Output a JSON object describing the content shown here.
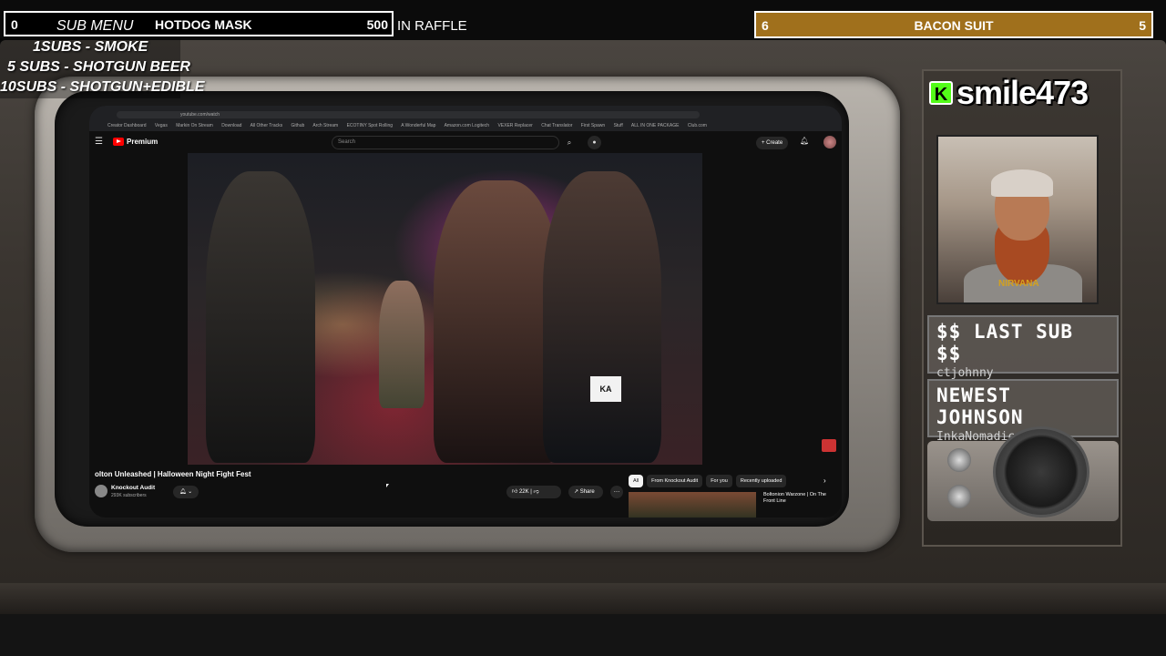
{
  "overlay": {
    "sub_menu_bar": {
      "count": "0",
      "label": "SUB MENU",
      "item": "HOTDOG MASK",
      "goal": "500"
    },
    "raffle_text": "IN RAFFLE",
    "sub_list": [
      "1SUBS   - SMOKE",
      "5 SUBS  - SHOTGUN BEER",
      "10SUBS - SHOTGUN+EDIBLE"
    ],
    "goal_bar": {
      "left": "6",
      "title": "BACON SUIT",
      "right": "5"
    }
  },
  "streamer": {
    "brand_icon": "K",
    "name": "smile473",
    "webcam_shirt_text": "NIRVANA"
  },
  "info_boxes": [
    {
      "heading": "$$ LAST SUB $$",
      "value": "ctjohnny"
    },
    {
      "heading": "NEWEST JOHNSON",
      "value": "InkaNomadic"
    }
  ],
  "browser": {
    "bookmarks": [
      "Creator Dashboard",
      "Vegas",
      "Markin On Stream",
      "Download",
      "All Other Tracks",
      "Github",
      "Arch Stream",
      "ECOTINY Spot Rolling",
      "A Wonderful Map",
      "Amazon.com Logitech",
      "VEXER Replacer",
      "Chat Translator",
      "First Spawn",
      "Stuff",
      "ALL IN ONE PACKAGE",
      "Club.com"
    ]
  },
  "youtube": {
    "logo_text": "Premium",
    "search_placeholder": "Search",
    "create_label": "+ Create",
    "video_badge": "KA",
    "video_title": "olton Unleashed | Halloween Night Fight Fest",
    "channel_name": "Knockout Audit",
    "channel_subs": "293K subscribers",
    "likes": "22K",
    "share_label": "Share",
    "chips": [
      "All",
      "From Knockout Audit",
      "For you",
      "Recently uploaded"
    ],
    "reco_title": "Boltonion Warzone | On The Front Line"
  }
}
